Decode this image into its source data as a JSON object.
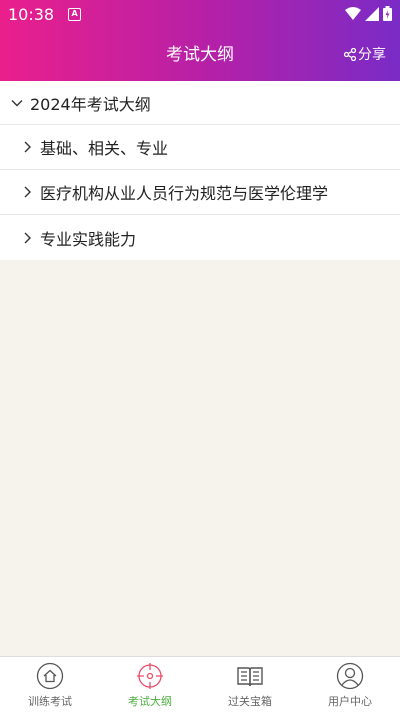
{
  "status_bar": {
    "time": "10:38"
  },
  "nav": {
    "title": "考试大纲",
    "share_label": "分享"
  },
  "outline": {
    "group_title": "2024年考试大纲",
    "items": [
      {
        "label": "基础、相关、专业"
      },
      {
        "label": "医疗机构从业人员行为规范与医学伦理学"
      },
      {
        "label": "专业实践能力"
      }
    ]
  },
  "tabbar": {
    "tabs": [
      {
        "label": "训练考试",
        "icon": "home-icon"
      },
      {
        "label": "考试大纲",
        "icon": "target-icon",
        "active": true
      },
      {
        "label": "过关宝箱",
        "icon": "book-icon"
      },
      {
        "label": "用户中心",
        "icon": "user-icon"
      }
    ]
  },
  "colors": {
    "header_gradient": [
      "#ea1f8c",
      "#7a2bc6"
    ],
    "active_tab": "#4caf3f",
    "active_icon": "#e94d6a",
    "background": "#f6f3ec"
  }
}
